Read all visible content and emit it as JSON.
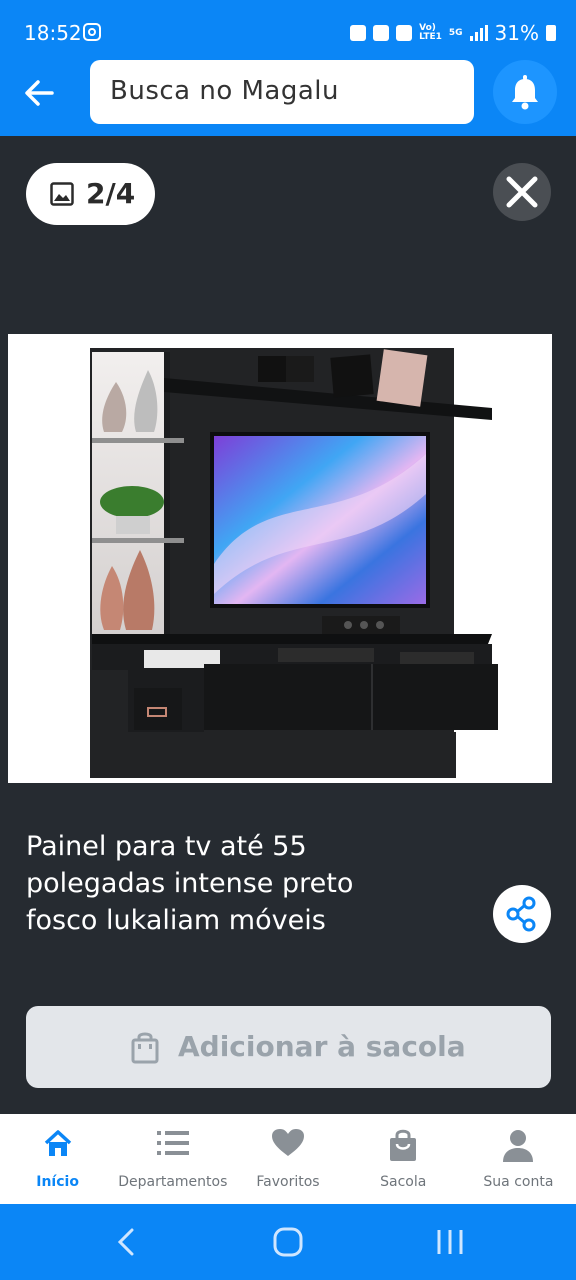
{
  "status_bar": {
    "time": "18:52",
    "network_small_top": "Vo)",
    "network_small_bottom": "LTE1",
    "network_5g": "5G",
    "battery": "31%"
  },
  "header": {
    "search_placeholder": "Busca no Magalu"
  },
  "gallery": {
    "counter": "2/4",
    "image_alt": "Painel para tv com prateleiras laterais e TV"
  },
  "product": {
    "title_line1": "Painel para tv até 55",
    "title_line2": "polegadas intense preto",
    "title_line3": "fosco lukaliam móveis"
  },
  "actions": {
    "add_to_bag": "Adicionar à sacola"
  },
  "bottom_nav": {
    "items": [
      {
        "label": "Início",
        "icon": "home-icon",
        "active": true
      },
      {
        "label": "Departamentos",
        "icon": "list-icon",
        "active": false
      },
      {
        "label": "Favoritos",
        "icon": "heart-icon",
        "active": false
      },
      {
        "label": "Sacola",
        "icon": "bag-icon",
        "active": false
      },
      {
        "label": "Sua conta",
        "icon": "user-icon",
        "active": false
      }
    ]
  },
  "colors": {
    "brand_blue": "#0b86f6",
    "background_dark": "#262b31"
  }
}
